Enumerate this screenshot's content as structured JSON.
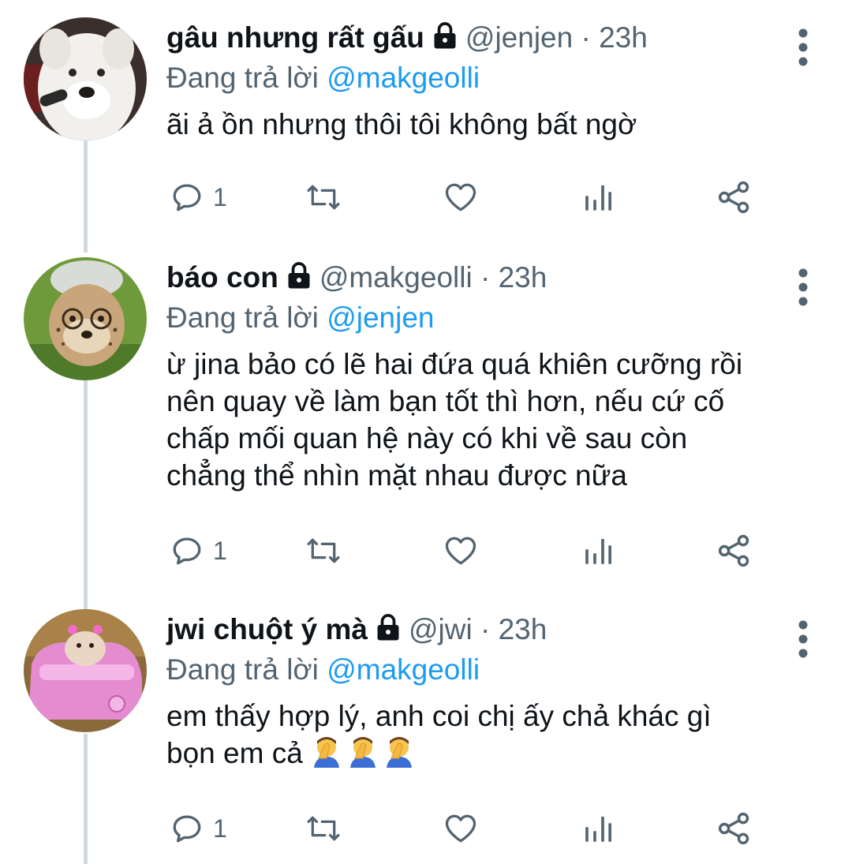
{
  "colors": {
    "text": "#0f1419",
    "secondary": "#536471",
    "mention": "#1d9bf0",
    "thread_line": "#cfd9de"
  },
  "tweets": [
    {
      "name": "gâu nhưng rất gấu",
      "handle": "@jenjen",
      "separator": "·",
      "time": "23h",
      "reply_prefix": "Đang trả lời ",
      "reply_to": "@makgeolli",
      "text": "ãi ả ồn nhưng thôi tôi không bất ngờ",
      "reply_count": "1",
      "avatar": "white-dog-avatar"
    },
    {
      "name": "báo con",
      "handle": "@makgeolli",
      "separator": "·",
      "time": "23h",
      "reply_prefix": "Đang trả lời ",
      "reply_to": "@jenjen",
      "text": "ừ jina bảo có lẽ hai đứa quá khiên cưỡng rồi\nnên quay về làm bạn tốt thì hơn, nếu cứ cố\nchấp mối quan hệ này có khi về sau còn\nchẳng thể nhìn mặt nhau được nữa",
      "reply_count": "1",
      "avatar": "cheetah-cub-avatar"
    },
    {
      "name": "jwi chuột ý mà",
      "handle": "@jwi",
      "separator": "·",
      "time": "23h",
      "reply_prefix": "Đang trả lời ",
      "reply_to": "@makgeolli",
      "text": "em thấy hợp lý, anh coi chị ấy chả khác gì\nbọn em cả ",
      "emojis": [
        "facepalm-emoji",
        "facepalm-emoji",
        "facepalm-emoji"
      ],
      "reply_count": "1",
      "avatar": "hamster-pink-car-avatar"
    }
  ]
}
